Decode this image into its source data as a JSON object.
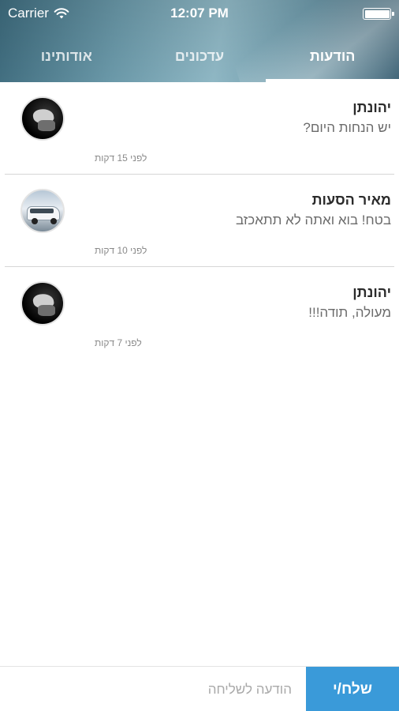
{
  "status_bar": {
    "carrier": "Carrier",
    "time": "12:07 PM"
  },
  "tabs": [
    {
      "label": "הודעות",
      "active": true
    },
    {
      "label": "עדכונים",
      "active": false
    },
    {
      "label": "אודותינו",
      "active": false
    }
  ],
  "messages": [
    {
      "sender": "יהונתן",
      "text": "יש הנחות היום?",
      "time": "לפני 15 דקות",
      "avatar": "dark-portrait"
    },
    {
      "sender": "מאיר הסעות",
      "text": "בטח! בוא ואתה לא תתאכזב",
      "time": "לפני 10 דקות",
      "avatar": "van-photo"
    },
    {
      "sender": "יהונתן",
      "text": "מעולה, תודה!!!",
      "time": "לפני 7 דקות",
      "avatar": "dark-portrait"
    }
  ],
  "composer": {
    "placeholder": "הודעה לשליחה",
    "value": "",
    "send_label": "שלח/י"
  },
  "colors": {
    "accent": "#3a9ad9",
    "header": "#6a98a8"
  }
}
